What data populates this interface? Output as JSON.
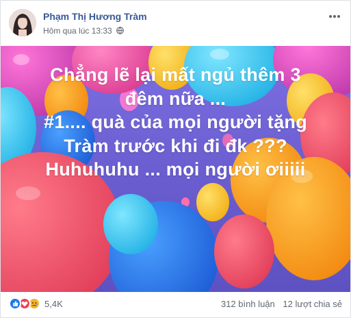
{
  "post": {
    "author": "Phạm Thị Hương Tràm",
    "timestamp": "Hôm qua lúc 13:33",
    "privacy_icon": "globe-icon",
    "more_icon": "more-options-icon",
    "lines": [
      "Chẳng lẽ lại mất ngủ thêm 3",
      "đêm nữa ...",
      "#1.... quà của mọi người tặng",
      "Tràm trước khi đi đk ???",
      "Huhuhuhu ... mọi người ơiiiii"
    ]
  },
  "footer": {
    "reaction_icons": [
      "like-icon",
      "love-icon",
      "sad-icon"
    ],
    "reaction_count": "5,4K",
    "comments": "312 bình luận",
    "shares": "12 lượt chia sẻ"
  },
  "colors": {
    "author": "#385898",
    "meta": "#616770",
    "background_purple": "#6f63d6",
    "text": "#ffffff"
  }
}
